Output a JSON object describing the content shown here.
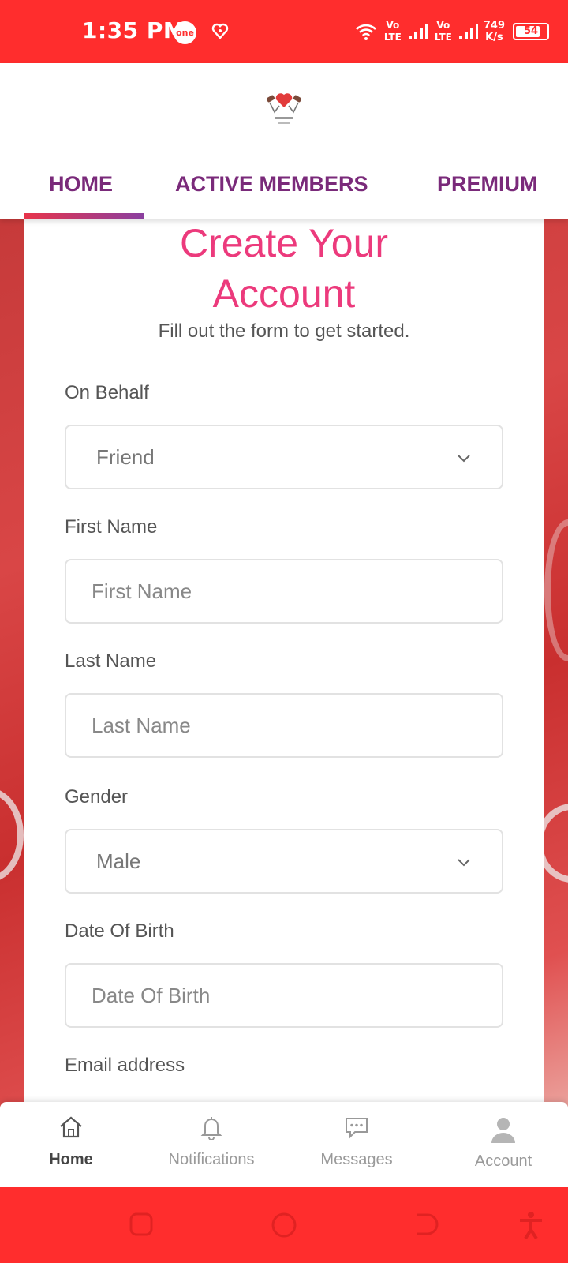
{
  "status_bar": {
    "time": "1:35 PM",
    "badge": "one",
    "network_label_1": "Vo LTE",
    "network_label_2": "Vo LTE",
    "speed_value": "749",
    "speed_unit": "K/s",
    "battery": "54"
  },
  "tabs": [
    {
      "label": "HOME"
    },
    {
      "label": "ACTIVE MEMBERS"
    },
    {
      "label": "PREMIUM"
    }
  ],
  "form": {
    "title_line1": "Create Your",
    "title_line2": "Account",
    "subtitle": "Fill out the form to get started.",
    "on_behalf_label": "On Behalf",
    "on_behalf_value": "Friend",
    "first_name_label": "First Name",
    "first_name_placeholder": "First Name",
    "last_name_label": "Last Name",
    "last_name_placeholder": "Last Name",
    "gender_label": "Gender",
    "gender_value": "Male",
    "dob_label": "Date Of Birth",
    "dob_placeholder": "Date Of Birth",
    "email_label": "Email address"
  },
  "bottom_nav": [
    {
      "label": "Home",
      "icon": "home-icon"
    },
    {
      "label": "Notifications",
      "icon": "bell-icon"
    },
    {
      "label": "Messages",
      "icon": "chat-icon"
    },
    {
      "label": "Account",
      "icon": "user-icon"
    }
  ],
  "colors": {
    "status_bar": "#ff2d2d",
    "tab_text": "#7a2a7a",
    "title": "#ec3a7c"
  }
}
